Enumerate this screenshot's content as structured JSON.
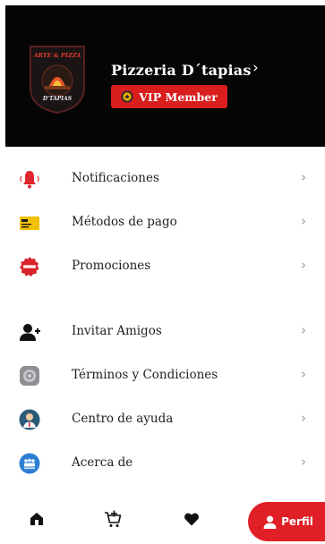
{
  "header": {
    "shop_name": "Pizzeria D´tapias",
    "vip_label": "VIP Member",
    "logo_text_top": "ARTE & PIZZA",
    "logo_text_bottom": "D'TAPIAS"
  },
  "menu": [
    {
      "label": "Notificaciones",
      "icon": "bell-icon"
    },
    {
      "label": "Métodos de pago",
      "icon": "payment-card-icon"
    },
    {
      "label": "Promociones",
      "icon": "special-offer-icon"
    },
    {
      "label": "Invitar Amigos",
      "icon": "add-user-icon"
    },
    {
      "label": "Términos y Condiciones",
      "icon": "settings-gear-icon"
    },
    {
      "label": "Centro de ayuda",
      "icon": "support-agent-icon"
    },
    {
      "label": "Acerca de",
      "icon": "group-info-icon"
    }
  ],
  "nav": {
    "profile_label": "Perfil"
  },
  "colors": {
    "accent": "#e01f26",
    "header_bg": "#050505",
    "vip_bg": "#d91e1e"
  }
}
